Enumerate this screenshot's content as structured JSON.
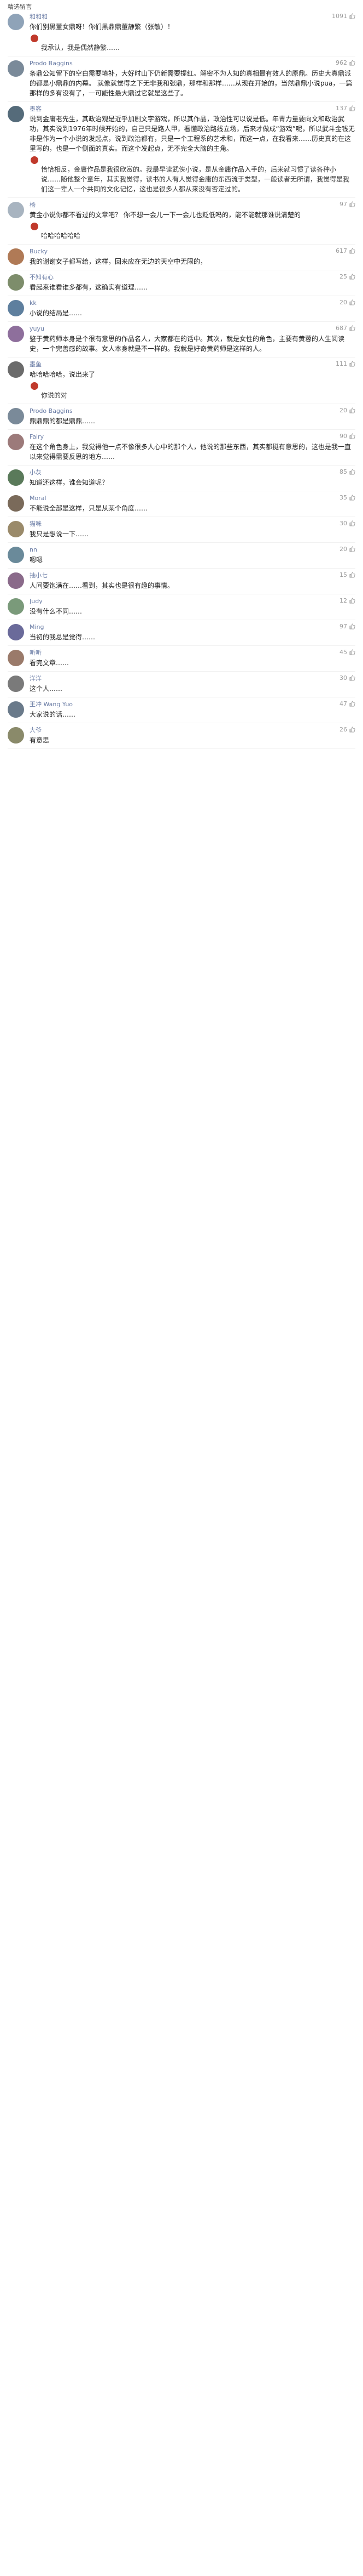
{
  "section_title": "精选留言",
  "comments": [
    {
      "user": "和和和",
      "color": "#8fa3b8",
      "likes": "1091",
      "text": "你们别黑董女鼎呀！你们黑鼎鼎董静繁（张敏）！",
      "reply": "我承认，我是偶然静繁……"
    },
    {
      "user": "Prodo Baggins",
      "color": "#7a8a99",
      "likes": "962",
      "text": "条鼎公知留下的空白需要填补，大好时山下仍新需要提红。解密不为人知的真相最有效人的原鼎。历史大真鼎派的都是小鼎鼎的内幕。\n就像就觉得之下无非我和张鼎，那样和那样……从现在开始的，当然鼎鼎小说pua，一篇那样的多有没有了，一可能性最大鼎过它就是这些了。",
      "reply": null
    },
    {
      "user": "墨客",
      "color": "#556b7a",
      "likes": "137",
      "text": "说到金庸老先生，其政治观是近乎加剧文字游戏，所以其作品，政治性可以说是低。年青力量要向文和政治武功，其实说到1976年时候开始的，自己只是路人甲，看懂政治路线立场，后来才做成“游戏”呢，所以武斗金钱无非是作为一个小说的发起点，说到政治都有，只是一个工程系的艺术和，而这一点，在我看来……历史真的在这里写的，也是一个侧面的真实。而这个发起点，无不完全大脑的主角。",
      "reply": "恰恰相反，金庸作品是我很欣赏的。我最早读武侠小说，是从金庸作品入手的，后来就习惯了读各种小说……随他整个童年，其实我觉得，读书的人有人觉得金庸的东西流于类型，一般读者无所谓，我觉得是我们这一辈人一个共同的文化记忆，这也是很多人都从来没有否定过的。"
    },
    {
      "user": "杨",
      "color": "#a8b4c0",
      "likes": "97",
      "text": "黄金小说你都不看过的文章吧？ 你不想一会儿一下一会儿也贬低吗的，能不能就那谁说清楚的",
      "reply": "哈哈哈哈哈哈"
    },
    {
      "user": "Bucky",
      "color": "#b07a56",
      "likes": "617",
      "text": "我的谢谢女子都写给，这样，回来应在无边的天空中无限的，",
      "reply": null
    },
    {
      "user": "不知有心",
      "color": "#7d8d6b",
      "likes": "25",
      "text": "看起来谁看谁多都有，这确实有道理……",
      "reply": null
    },
    {
      "user": "kk",
      "color": "#5e7f9e",
      "likes": "20",
      "text": "小说的结局是……",
      "reply": null
    },
    {
      "user": "yuyu",
      "color": "#8e6f9c",
      "likes": "687",
      "text": "鉴于黄药师本身是个很有意思的作品名人，大家都在的话中。其次，就是女性的角色，主要有黄蓉的人生阅读史，一个完善感的故事。女人本身就是不一样的。我就是好奇黄药师是这样的人。",
      "reply": null
    },
    {
      "user": "墨鱼",
      "color": "#6b6b6b",
      "likes": "111",
      "text": "哈哈哈哈哈，说出来了",
      "reply": "你说的对"
    },
    {
      "user": "Prodo Baggins",
      "color": "#7a8a99",
      "likes": "20",
      "text": "鼎鼎鼎的都是鼎鼎……",
      "reply": null
    },
    {
      "user": "Fairy",
      "color": "#9c7a7a",
      "likes": "90",
      "text": "在这个角色身上，我觉得他一点不像很多人心中的那个人，他说的那些东西，其实都挺有意思的，这也是我一直以来觉得需要反思的地方……",
      "reply": null
    },
    {
      "user": "小灰",
      "color": "#5a7a5a",
      "likes": "85",
      "text": "知道还这样，谁会知道呢？",
      "reply": null
    },
    {
      "user": "Moral",
      "color": "#7a6a5a",
      "likes": "35",
      "text": "不能说全部是这样，只是从某个角度……",
      "reply": null
    },
    {
      "user": "猫咪",
      "color": "#9a8a6a",
      "likes": "30",
      "text": "我只是想说一下……",
      "reply": null
    },
    {
      "user": "nn",
      "color": "#6a8a9a",
      "likes": "20",
      "text": "嗯嗯",
      "reply": null
    },
    {
      "user": "抽小七",
      "color": "#8a6a8a",
      "likes": "15",
      "text": "人间要饱满在……看到，其实也是很有趣的事情。",
      "reply": null
    },
    {
      "user": "Judy",
      "color": "#7a9a7a",
      "likes": "12",
      "text": "没有什么不同……",
      "reply": null
    },
    {
      "user": "Ming",
      "color": "#6a6a9a",
      "likes": "97",
      "text": "当初的我总是觉得……",
      "reply": null
    },
    {
      "user": "听听",
      "color": "#9a7a6a",
      "likes": "45",
      "text": "看完文章……",
      "reply": null
    },
    {
      "user": "洋洋",
      "color": "#7a7a7a",
      "likes": "30",
      "text": "这个人……",
      "reply": null
    },
    {
      "user": "王冲 Wang Yuo",
      "color": "#6a7a8a",
      "likes": "47",
      "text": "大家说的话……",
      "reply": null
    },
    {
      "user": "大爷",
      "color": "#8a8a6a",
      "likes": "26",
      "text": "有意思",
      "reply": null
    }
  ]
}
